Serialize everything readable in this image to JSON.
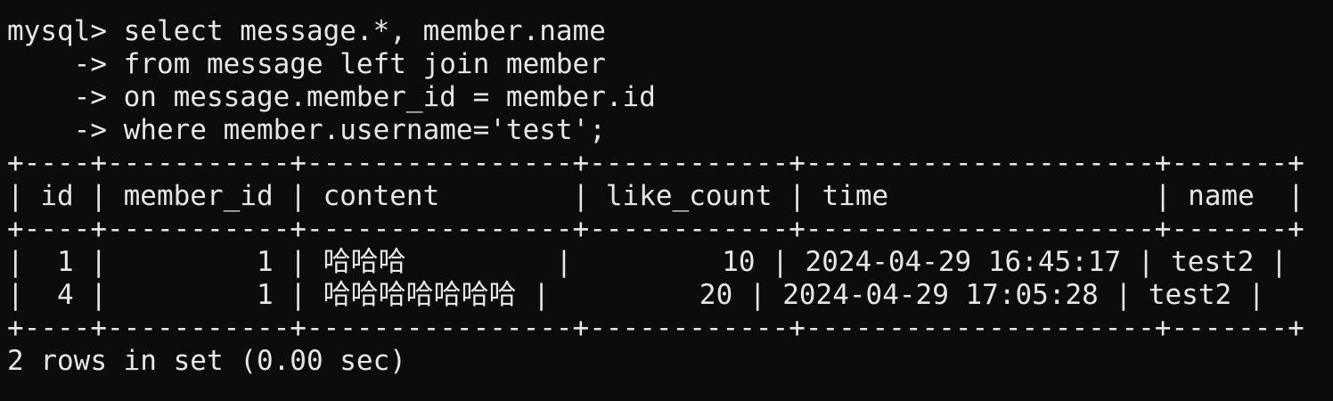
{
  "terminal": {
    "query_lines": [
      "mysql> select message.*, member.name",
      "    -> from message left join member",
      "    -> on message.member_id = member.id",
      "    -> where member.username='test';"
    ],
    "table": {
      "border": "+----+-----------+----------------+------------+---------------------+-------+",
      "header": "| id | member_id | content        | like_count | time                | name  |",
      "rows": [
        "|  1 |         1 | 哈哈哈         |         10 | 2024-04-29 16:45:17 | test2 |",
        "|  4 |         1 | 哈哈哈哈哈哈哈 |         20 | 2024-04-29 17:05:28 | test2 |"
      ],
      "columns": [
        "id",
        "member_id",
        "content",
        "like_count",
        "time",
        "name"
      ],
      "data": [
        {
          "id": "1",
          "member_id": "1",
          "content": "哈哈哈",
          "like_count": "10",
          "time": "2024-04-29 16:45:17",
          "name": "test2"
        },
        {
          "id": "4",
          "member_id": "1",
          "content": "哈哈哈哈哈哈哈",
          "like_count": "20",
          "time": "2024-04-29 17:05:28",
          "name": "test2"
        }
      ]
    },
    "result_summary": "2 rows in set (0.00 sec)"
  },
  "colors": {
    "background": "#0c0c0c",
    "text": "#e6e6e6"
  }
}
